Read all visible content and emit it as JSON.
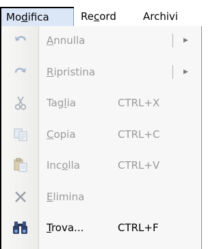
{
  "menubar": {
    "items": [
      {
        "pre": "Mo",
        "acc": "d",
        "post": "ifica"
      },
      {
        "pre": "Re",
        "acc": "c",
        "post": "ord"
      },
      {
        "pre": "Archivi",
        "acc": "",
        "post": ""
      }
    ]
  },
  "menu": {
    "items": [
      {
        "pre": "",
        "acc": "A",
        "post": "nnulla",
        "shortcut": "",
        "submenu": true,
        "icon": "undo-icon"
      },
      {
        "pre": "",
        "acc": "R",
        "post": "ipristina",
        "shortcut": "",
        "submenu": true,
        "icon": "redo-icon"
      },
      {
        "pre": "Tag",
        "acc": "l",
        "post": "ia",
        "shortcut": "CTRL+X",
        "submenu": false,
        "icon": "scissors-icon"
      },
      {
        "pre": "",
        "acc": "C",
        "post": "opia",
        "shortcut": "CTRL+C",
        "submenu": false,
        "icon": "copy-icon"
      },
      {
        "pre": "Inc",
        "acc": "o",
        "post": "lla",
        "shortcut": "CTRL+V",
        "submenu": false,
        "icon": "paste-icon"
      },
      {
        "pre": "",
        "acc": "E",
        "post": "limina",
        "shortcut": "",
        "submenu": false,
        "icon": "delete-icon"
      },
      {
        "pre": "",
        "acc": "T",
        "post": "rova...",
        "shortcut": "CTRL+F",
        "submenu": false,
        "icon": "binoculars-icon"
      }
    ],
    "submenu_arrow": "▶"
  },
  "colors": {
    "disabled_text": "#9a9a9a",
    "active_menu_bg": "#dbe6f7",
    "menu_bg": "#f7f7f7"
  }
}
